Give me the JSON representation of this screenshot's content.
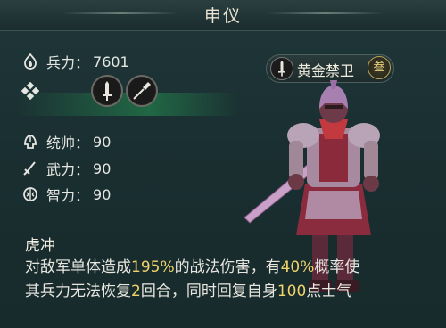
{
  "title": "申仪",
  "stats": {
    "troops": {
      "label": "兵力：",
      "value": "7601",
      "icon": "fist-flame-icon"
    },
    "command": {
      "label": "统帅：",
      "value": "90",
      "icon": "helmet-icon"
    },
    "force": {
      "label": "武力：",
      "value": "90",
      "icon": "sword-icon"
    },
    "intellect": {
      "label": "智力：",
      "value": "90",
      "icon": "brain-icon"
    }
  },
  "troop_type_icon": "diamond-cross-icon",
  "equipment_icons": [
    "sword-weapon-icon",
    "spear-weapon-icon"
  ],
  "unit_badge": {
    "label": "黄金禁卫",
    "number": "叁",
    "icon": "sword-badge-icon"
  },
  "skill": {
    "name": "虎冲",
    "line1": {
      "p1": "对敌军单体造成",
      "v1": "195%",
      "p2": "的战法伤害，有",
      "v2": "40%",
      "p3": "概率使"
    },
    "line2": {
      "p1": "其兵力无法恢复",
      "v1": "2",
      "p2": "回合，同时回复自身",
      "v2": "100",
      "p3": "点士气"
    }
  },
  "colors": {
    "highlight": "#f1d36b",
    "text": "#e8e6df",
    "background": "#1a2f31"
  }
}
